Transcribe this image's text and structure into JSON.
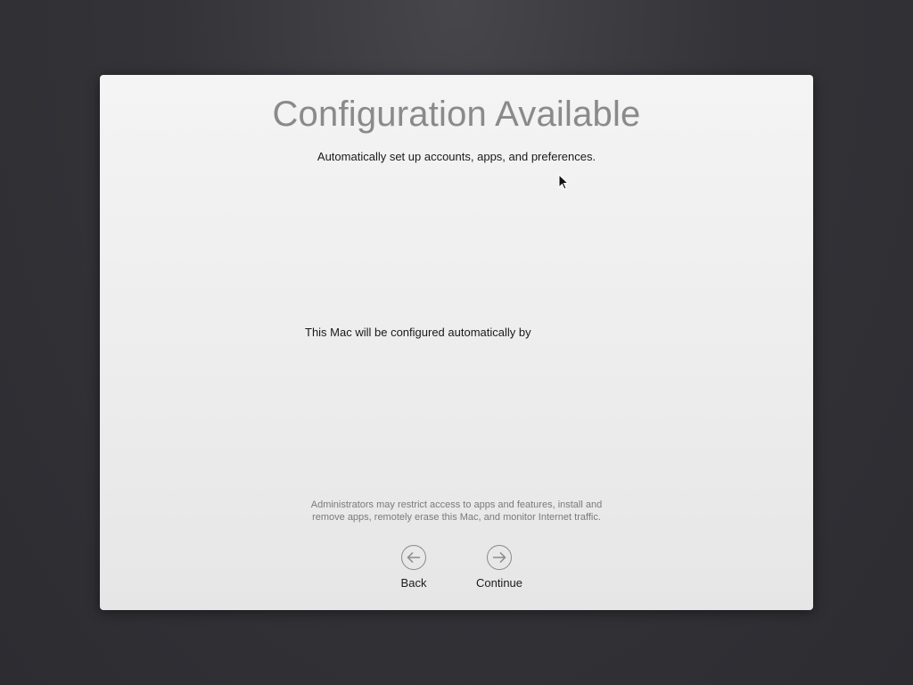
{
  "setup": {
    "title": "Configuration Available",
    "subtitle": "Automatically set up accounts, apps, and preferences.",
    "configured_by_text": "This Mac will be configured automatically by",
    "disclaimer_line1": "Administrators may restrict access to apps and features, install and",
    "disclaimer_line2": "remove apps, remotely erase this Mac, and monitor Internet traffic."
  },
  "navigation": {
    "back_label": "Back",
    "back_icon": "arrow-left-circle-icon",
    "continue_label": "Continue",
    "continue_icon": "arrow-right-circle-icon"
  },
  "colors": {
    "background": "#333338",
    "panel": "#f0f0f0",
    "title": "#8a8a8a",
    "body_text": "#1a1a1a",
    "muted_text": "#7a7a7a"
  }
}
